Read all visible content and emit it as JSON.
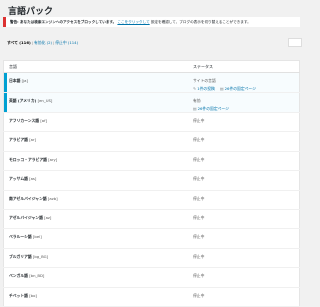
{
  "page": {
    "title": "言語パック"
  },
  "notice": {
    "bold": "警告: あなたは検索エンジンへのアクセスをブロックしています。",
    "link": "ここをクリックして",
    "after": "設定を確認して、ブログの表示を切り替えることができます。"
  },
  "filters": {
    "all": "すべて (116)",
    "enabled": "有効化 (2)",
    "disabled": "停止中 (114)"
  },
  "table": {
    "headers": {
      "language": "言語",
      "status": "ステータス"
    },
    "rows": [
      {
        "name": "日本語 [ja]",
        "status": "サイトの言語",
        "actions": [
          "1件の投稿",
          "26件の固定ページ"
        ],
        "active": true
      },
      {
        "name": "英語 (アメリカ) [en_US]",
        "status": "有効",
        "actions": [
          "26件の固定ページ"
        ],
        "active": true
      },
      {
        "name": "アフリカーンス語 [af]",
        "status": "停止中"
      },
      {
        "name": "アラビア語 [ar]",
        "status": "停止中"
      },
      {
        "name": "モロッコ・アラビア語 [ary]",
        "status": "停止中"
      },
      {
        "name": "アッサム語 [as]",
        "status": "停止中"
      },
      {
        "name": "南アゼルバイジャン語 [azb]",
        "status": "停止中"
      },
      {
        "name": "アゼルバイジャン語 [az]",
        "status": "停止中"
      },
      {
        "name": "ベラルーシ語 [bel]",
        "status": "停止中"
      },
      {
        "name": "ブルガリア語 [bg_BG]",
        "status": "停止中"
      },
      {
        "name": "ベンガル語 [bn_BD]",
        "status": "停止中"
      },
      {
        "name": "チベット語 [bo]",
        "status": "停止中"
      }
    ]
  }
}
